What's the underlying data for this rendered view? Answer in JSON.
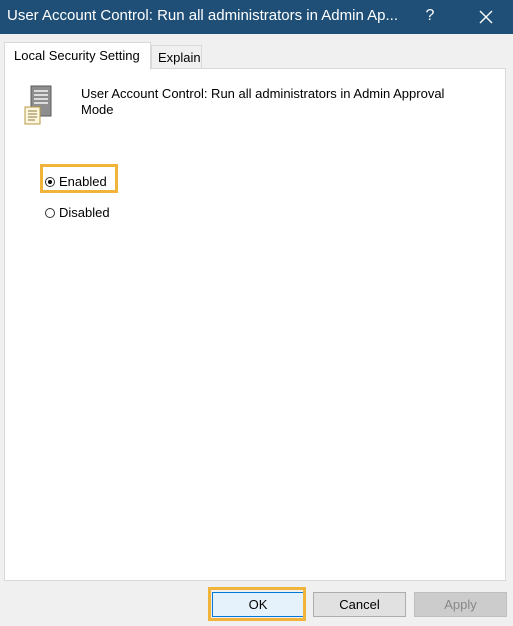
{
  "window": {
    "title": "User Account Control: Run all administrators in Admin Ap...",
    "help_glyph": "?",
    "titlebar_color": "#1f4f76",
    "close_icon": "close-icon"
  },
  "tabs": [
    {
      "label": "Local Security Setting",
      "selected": true
    },
    {
      "label": "Explain",
      "selected": false
    }
  ],
  "policy": {
    "icon": "server-policy-icon",
    "name": "User Account Control: Run all administrators in Admin Approval Mode"
  },
  "options": {
    "enabled": {
      "label": "Enabled",
      "checked": true
    },
    "disabled": {
      "label": "Disabled",
      "checked": false
    }
  },
  "buttons": {
    "ok": "OK",
    "cancel": "Cancel",
    "apply": "Apply",
    "apply_disabled": true
  },
  "highlight_color": "#f0b43a"
}
